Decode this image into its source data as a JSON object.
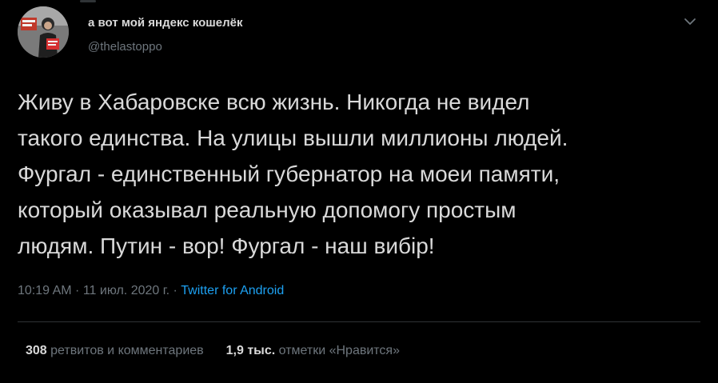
{
  "author": {
    "display_name": "а вот мой яндекс кошелёк",
    "handle": "@thelastoppo"
  },
  "tweet": {
    "lines": [
      "Живу в Хабаровске всю жизнь. Никогда не видел",
      "такого единства. На улицы вышли миллионы людей.",
      "Фургал - единственный губернатор на моеи памяти,",
      "который оказывал реальную допомогу простым",
      "людям. Путин - вор! Фургал - наш вибір!"
    ]
  },
  "meta": {
    "time": "10:19 AM",
    "separator": " · ",
    "date": "11 июл. 2020 г.",
    "source": "Twitter for Android"
  },
  "stats": {
    "retweets_count": "308",
    "retweets_label": "ретвитов и комментариев",
    "likes_count": "1,9 тыс.",
    "likes_label": "отметки «Нравится»"
  },
  "icons": {
    "menu": "chevron-down-icon",
    "avatar": "avatar"
  },
  "colors": {
    "background": "#000000",
    "text": "#d9d9d9",
    "muted": "#6e767d",
    "link": "#1da1f2",
    "divider": "#2f3336"
  }
}
